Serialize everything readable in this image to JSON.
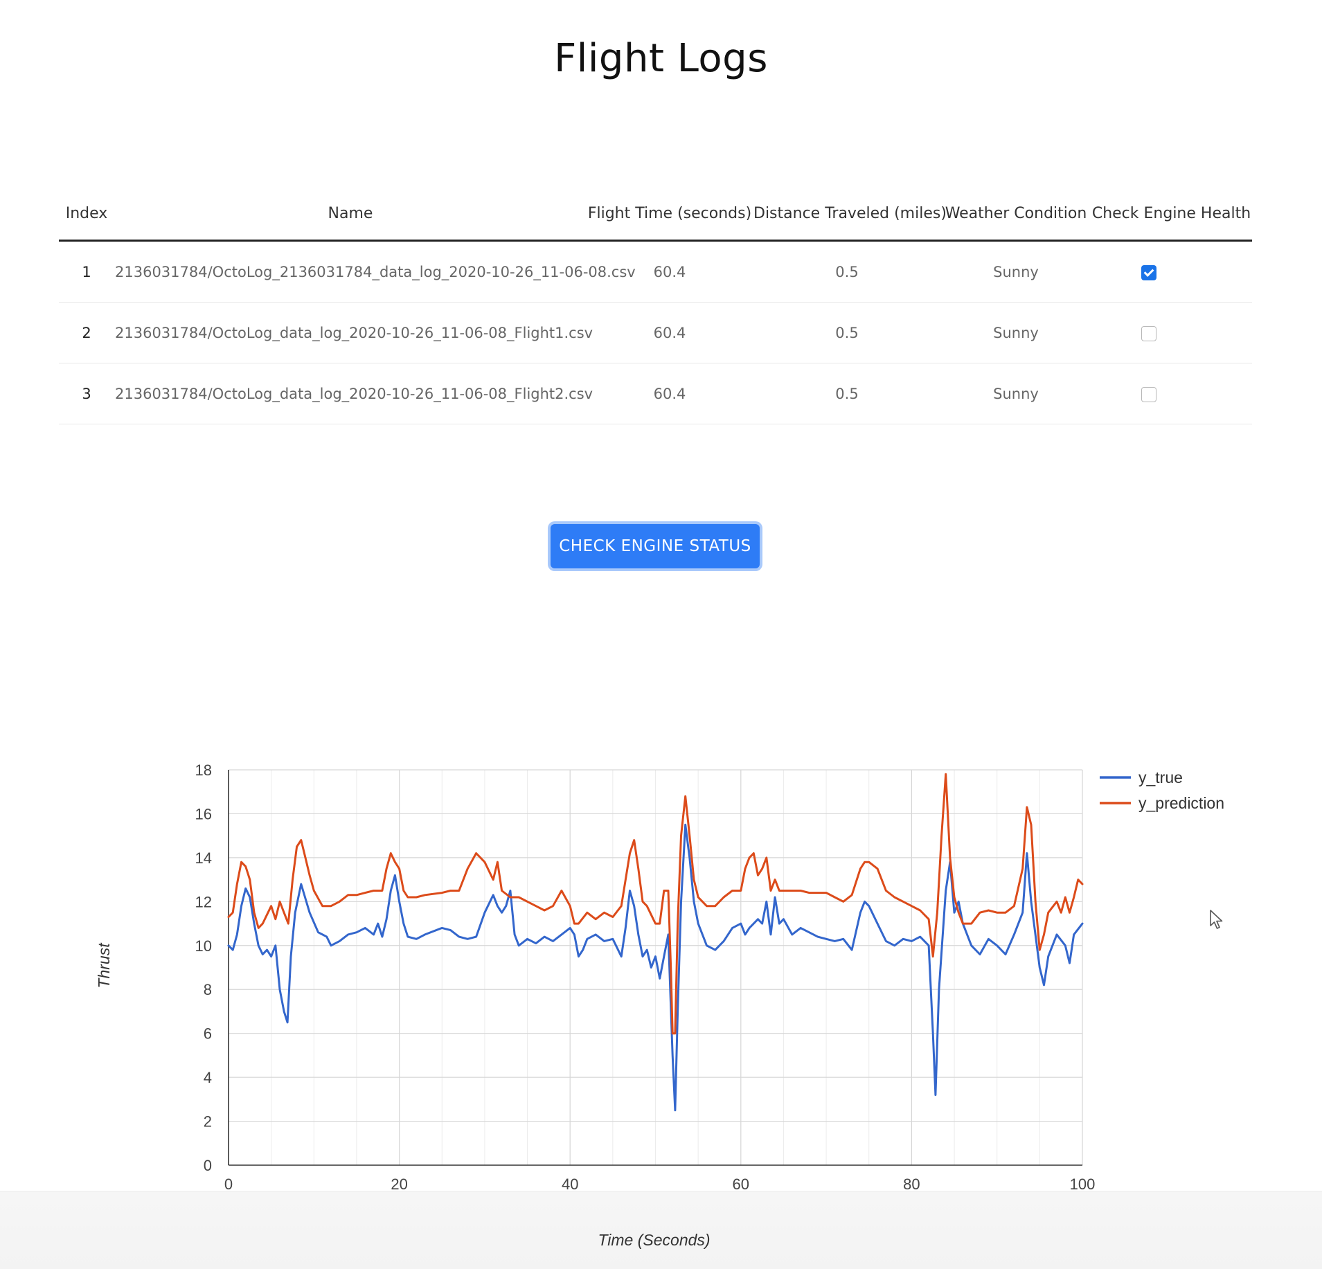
{
  "page": {
    "title": "Flight Logs"
  },
  "table": {
    "headers": [
      "Index",
      "Name",
      "Flight Time (seconds)",
      "Distance Traveled (miles)",
      "Weather Condition",
      "Check Engine Health"
    ],
    "rows": [
      {
        "index": "1",
        "name": "2136031784/OctoLog_2136031784_data_log_2020-10-26_11-06-08.csv",
        "flight_time": "60.4",
        "distance": "0.5",
        "weather": "Sunny",
        "checked": true
      },
      {
        "index": "2",
        "name": "2136031784/OctoLog_data_log_2020-10-26_11-06-08_Flight1.csv",
        "flight_time": "60.4",
        "distance": "0.5",
        "weather": "Sunny",
        "checked": false
      },
      {
        "index": "3",
        "name": "2136031784/OctoLog_data_log_2020-10-26_11-06-08_Flight2.csv",
        "flight_time": "60.4",
        "distance": "0.5",
        "weather": "Sunny",
        "checked": false
      }
    ]
  },
  "button": {
    "label": "CHECK ENGINE STATUS"
  },
  "colors": {
    "accent": "#2e7cf6",
    "y_true": "#3366cc",
    "y_prediction": "#dc4b1a"
  },
  "chart_data": {
    "type": "line",
    "xlabel": "Time (Seconds)",
    "ylabel": "Thrust",
    "xlim": [
      0,
      100
    ],
    "ylim": [
      0,
      18
    ],
    "xticks": [
      0,
      20,
      40,
      60,
      80,
      100
    ],
    "yticks": [
      0,
      2,
      4,
      6,
      8,
      10,
      12,
      14,
      16,
      18
    ],
    "grid": true,
    "legend_position": "right",
    "series": [
      {
        "name": "y_true",
        "color": "#3366cc",
        "points": [
          [
            0,
            10
          ],
          [
            0.5,
            9.8
          ],
          [
            1,
            10.5
          ],
          [
            1.5,
            11.8
          ],
          [
            2,
            12.6
          ],
          [
            2.5,
            12.2
          ],
          [
            3,
            11
          ],
          [
            3.5,
            10
          ],
          [
            4,
            9.6
          ],
          [
            4.5,
            9.8
          ],
          [
            5,
            9.5
          ],
          [
            5.5,
            10
          ],
          [
            6,
            8
          ],
          [
            6.5,
            7
          ],
          [
            6.9,
            6.5
          ],
          [
            7.3,
            9.5
          ],
          [
            7.8,
            11.5
          ],
          [
            8.5,
            12.8
          ],
          [
            9.5,
            11.5
          ],
          [
            10.5,
            10.6
          ],
          [
            11.5,
            10.4
          ],
          [
            12,
            10
          ],
          [
            13,
            10.2
          ],
          [
            14,
            10.5
          ],
          [
            15,
            10.6
          ],
          [
            16,
            10.8
          ],
          [
            17,
            10.5
          ],
          [
            17.5,
            11
          ],
          [
            18,
            10.4
          ],
          [
            18.5,
            11.2
          ],
          [
            19,
            12.5
          ],
          [
            19.5,
            13.2
          ],
          [
            20,
            12
          ],
          [
            20.5,
            11
          ],
          [
            21,
            10.4
          ],
          [
            22,
            10.3
          ],
          [
            23,
            10.5
          ],
          [
            25,
            10.8
          ],
          [
            26,
            10.7
          ],
          [
            27,
            10.4
          ],
          [
            28,
            10.3
          ],
          [
            29,
            10.4
          ],
          [
            30,
            11.5
          ],
          [
            31,
            12.3
          ],
          [
            31.5,
            11.8
          ],
          [
            32,
            11.5
          ],
          [
            32.5,
            11.8
          ],
          [
            33,
            12.5
          ],
          [
            33.5,
            10.5
          ],
          [
            34,
            10
          ],
          [
            35,
            10.3
          ],
          [
            36,
            10.1
          ],
          [
            37,
            10.4
          ],
          [
            38,
            10.2
          ],
          [
            39,
            10.5
          ],
          [
            40,
            10.8
          ],
          [
            40.5,
            10.5
          ],
          [
            41,
            9.5
          ],
          [
            41.5,
            9.8
          ],
          [
            42,
            10.3
          ],
          [
            43,
            10.5
          ],
          [
            44,
            10.2
          ],
          [
            45,
            10.3
          ],
          [
            46,
            9.5
          ],
          [
            46.5,
            10.8
          ],
          [
            47,
            12.5
          ],
          [
            47.5,
            11.8
          ],
          [
            48,
            10.5
          ],
          [
            48.5,
            9.5
          ],
          [
            49,
            9.8
          ],
          [
            49.5,
            9
          ],
          [
            50,
            9.5
          ],
          [
            50.5,
            8.5
          ],
          [
            51,
            9.5
          ],
          [
            51.5,
            10.5
          ],
          [
            52,
            5
          ],
          [
            52.3,
            2.5
          ],
          [
            52.6,
            7
          ],
          [
            53,
            12
          ],
          [
            53.5,
            15.5
          ],
          [
            54,
            14
          ],
          [
            54.5,
            12
          ],
          [
            55,
            11
          ],
          [
            56,
            10
          ],
          [
            57,
            9.8
          ],
          [
            58,
            10.2
          ],
          [
            59,
            10.8
          ],
          [
            60,
            11
          ],
          [
            60.5,
            10.5
          ],
          [
            61,
            10.8
          ],
          [
            62,
            11.2
          ],
          [
            62.5,
            11
          ],
          [
            63,
            12
          ],
          [
            63.5,
            10.5
          ],
          [
            64,
            12.2
          ],
          [
            64.5,
            11
          ],
          [
            65,
            11.2
          ],
          [
            66,
            10.5
          ],
          [
            67,
            10.8
          ],
          [
            68,
            10.6
          ],
          [
            69,
            10.4
          ],
          [
            70,
            10.3
          ],
          [
            71,
            10.2
          ],
          [
            72,
            10.3
          ],
          [
            73,
            9.8
          ],
          [
            74,
            11.5
          ],
          [
            74.5,
            12
          ],
          [
            75,
            11.8
          ],
          [
            76,
            11
          ],
          [
            77,
            10.2
          ],
          [
            78,
            10
          ],
          [
            79,
            10.3
          ],
          [
            80,
            10.2
          ],
          [
            81,
            10.4
          ],
          [
            82,
            10
          ],
          [
            82.5,
            6
          ],
          [
            82.8,
            3.2
          ],
          [
            83.2,
            8
          ],
          [
            84,
            12.5
          ],
          [
            84.5,
            13.8
          ],
          [
            85,
            11.5
          ],
          [
            85.5,
            12
          ],
          [
            86,
            11
          ],
          [
            87,
            10
          ],
          [
            88,
            9.6
          ],
          [
            89,
            10.3
          ],
          [
            90,
            10
          ],
          [
            91,
            9.6
          ],
          [
            92,
            10.5
          ],
          [
            93,
            11.5
          ],
          [
            93.5,
            14.2
          ],
          [
            94,
            12
          ],
          [
            95,
            9
          ],
          [
            95.5,
            8.2
          ],
          [
            96,
            9.5
          ],
          [
            97,
            10.5
          ],
          [
            98,
            10
          ],
          [
            98.5,
            9.2
          ],
          [
            99,
            10.5
          ],
          [
            100,
            11
          ]
        ]
      },
      {
        "name": "y_prediction",
        "color": "#dc4b1a",
        "points": [
          [
            0,
            11.3
          ],
          [
            0.5,
            11.5
          ],
          [
            1,
            12.8
          ],
          [
            1.5,
            13.8
          ],
          [
            2,
            13.6
          ],
          [
            2.5,
            13
          ],
          [
            3,
            11.5
          ],
          [
            3.5,
            10.8
          ],
          [
            4,
            11
          ],
          [
            5,
            11.8
          ],
          [
            5.5,
            11.2
          ],
          [
            6,
            12
          ],
          [
            6.5,
            11.5
          ],
          [
            7,
            11
          ],
          [
            7.5,
            13
          ],
          [
            8,
            14.5
          ],
          [
            8.5,
            14.8
          ],
          [
            9,
            14
          ],
          [
            9.5,
            13.2
          ],
          [
            10,
            12.5
          ],
          [
            11,
            11.8
          ],
          [
            12,
            11.8
          ],
          [
            13,
            12
          ],
          [
            14,
            12.3
          ],
          [
            15,
            12.3
          ],
          [
            16,
            12.4
          ],
          [
            17,
            12.5
          ],
          [
            18,
            12.5
          ],
          [
            18.5,
            13.5
          ],
          [
            19,
            14.2
          ],
          [
            19.5,
            13.8
          ],
          [
            20,
            13.5
          ],
          [
            20.5,
            12.5
          ],
          [
            21,
            12.2
          ],
          [
            22,
            12.2
          ],
          [
            23,
            12.3
          ],
          [
            25,
            12.4
          ],
          [
            26,
            12.5
          ],
          [
            27,
            12.5
          ],
          [
            28,
            13.5
          ],
          [
            29,
            14.2
          ],
          [
            30,
            13.8
          ],
          [
            31,
            13
          ],
          [
            31.5,
            13.8
          ],
          [
            32,
            12.5
          ],
          [
            33,
            12.2
          ],
          [
            34,
            12.2
          ],
          [
            35,
            12
          ],
          [
            36,
            11.8
          ],
          [
            37,
            11.6
          ],
          [
            38,
            11.8
          ],
          [
            39,
            12.5
          ],
          [
            40,
            11.8
          ],
          [
            40.5,
            11
          ],
          [
            41,
            11
          ],
          [
            42,
            11.5
          ],
          [
            43,
            11.2
          ],
          [
            44,
            11.5
          ],
          [
            45,
            11.3
          ],
          [
            46,
            11.8
          ],
          [
            47,
            14.2
          ],
          [
            47.5,
            14.8
          ],
          [
            48,
            13.5
          ],
          [
            48.5,
            12
          ],
          [
            49,
            11.8
          ],
          [
            50,
            11
          ],
          [
            50.5,
            11
          ],
          [
            51,
            12.5
          ],
          [
            51.5,
            12.5
          ],
          [
            51.8,
            9
          ],
          [
            52,
            6
          ],
          [
            52.3,
            6
          ],
          [
            52.6,
            11
          ],
          [
            53,
            15
          ],
          [
            53.5,
            16.8
          ],
          [
            54,
            15
          ],
          [
            54.5,
            13
          ],
          [
            55,
            12.2
          ],
          [
            56,
            11.8
          ],
          [
            57,
            11.8
          ],
          [
            58,
            12.2
          ],
          [
            59,
            12.5
          ],
          [
            60,
            12.5
          ],
          [
            60.5,
            13.5
          ],
          [
            61,
            14
          ],
          [
            61.5,
            14.2
          ],
          [
            62,
            13.2
          ],
          [
            62.5,
            13.5
          ],
          [
            63,
            14
          ],
          [
            63.5,
            12.5
          ],
          [
            64,
            13
          ],
          [
            64.5,
            12.5
          ],
          [
            65,
            12.5
          ],
          [
            66,
            12.5
          ],
          [
            67,
            12.5
          ],
          [
            68,
            12.4
          ],
          [
            69,
            12.4
          ],
          [
            70,
            12.4
          ],
          [
            71,
            12.2
          ],
          [
            72,
            12
          ],
          [
            73,
            12.3
          ],
          [
            74,
            13.5
          ],
          [
            74.5,
            13.8
          ],
          [
            75,
            13.8
          ],
          [
            76,
            13.5
          ],
          [
            77,
            12.5
          ],
          [
            78,
            12.2
          ],
          [
            79,
            12
          ],
          [
            80,
            11.8
          ],
          [
            81,
            11.6
          ],
          [
            82,
            11.2
          ],
          [
            82.5,
            9.5
          ],
          [
            83,
            11.5
          ],
          [
            83.5,
            15
          ],
          [
            84,
            17.8
          ],
          [
            84.5,
            14
          ],
          [
            85,
            12.2
          ],
          [
            85.5,
            11.5
          ],
          [
            86,
            11
          ],
          [
            87,
            11
          ],
          [
            88,
            11.5
          ],
          [
            89,
            11.6
          ],
          [
            90,
            11.5
          ],
          [
            91,
            11.5
          ],
          [
            92,
            11.8
          ],
          [
            93,
            13.5
          ],
          [
            93.5,
            16.3
          ],
          [
            94,
            15.5
          ],
          [
            94.5,
            12
          ],
          [
            95,
            9.8
          ],
          [
            95.5,
            10.5
          ],
          [
            96,
            11.5
          ],
          [
            97,
            12
          ],
          [
            97.5,
            11.5
          ],
          [
            98,
            12.2
          ],
          [
            98.5,
            11.5
          ],
          [
            99,
            12.2
          ],
          [
            99.5,
            13
          ],
          [
            100,
            12.8
          ]
        ]
      }
    ]
  }
}
